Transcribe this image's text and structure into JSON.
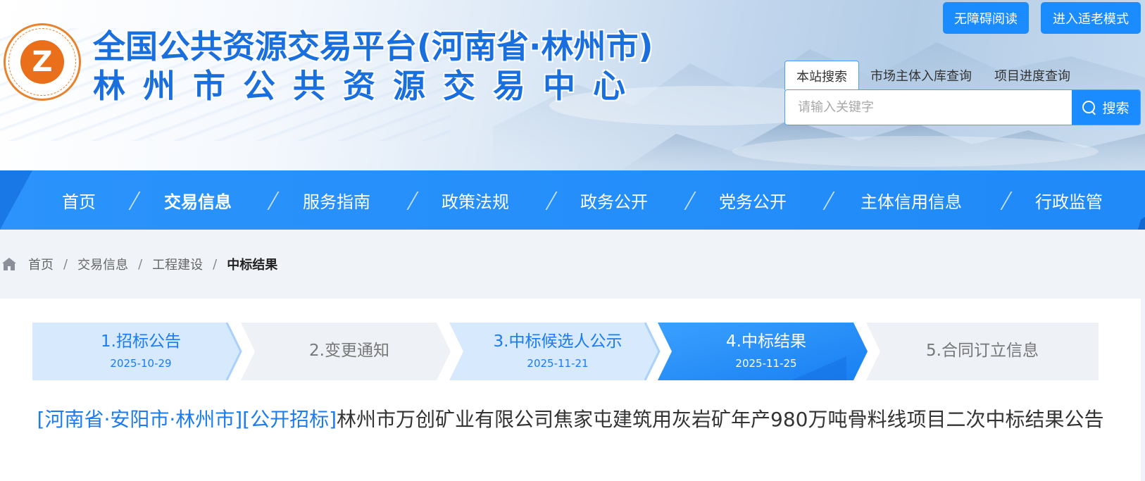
{
  "header": {
    "logo_name": "zhongyuan-logo",
    "title_line1": "全国公共资源交易平台(河南省·林州市)",
    "title_line2": "林州市公共资源交易中心",
    "accessibility_button": "无障碍阅读",
    "elder_mode_button": "进入适老模式",
    "search_tabs": [
      "本站搜索",
      "市场主体入库查询",
      "项目进度查询"
    ],
    "search_placeholder": "请输入关键字",
    "search_button": "搜索"
  },
  "nav": {
    "items": [
      "首页",
      "交易信息",
      "服务指南",
      "政策法规",
      "政务公开",
      "党务公开",
      "主体信用信息",
      "行政监管"
    ],
    "active_index": 1
  },
  "breadcrumb": {
    "items": [
      "首页",
      "交易信息",
      "工程建设",
      "中标结果"
    ],
    "separator": "/"
  },
  "steps": [
    {
      "label": "1.招标公告",
      "date": "2025-10-29",
      "state": "done"
    },
    {
      "label": "2.变更通知",
      "date": "",
      "state": "todo"
    },
    {
      "label": "3.中标候选人公示",
      "date": "2025-11-21",
      "state": "done"
    },
    {
      "label": "4.中标结果",
      "date": "2025-11-25",
      "state": "current"
    },
    {
      "label": "5.合同订立信息",
      "date": "",
      "state": "todo"
    }
  ],
  "article": {
    "region_tag": "[河南省·安阳市·林州市]",
    "method_tag": "[公开招标]",
    "title": "林州市万创矿业有限公司焦家屯建筑用灰岩矿年产980万吨骨料线项目二次中标结果公告"
  },
  "colors": {
    "primary": "#1a8cff",
    "title_blue": "#1a6fde",
    "link_blue": "#1a7cf0",
    "step_done_bg": "#d6e9fd",
    "step_todo_bg": "#eef2f7",
    "logo_orange": "#ea6f1a"
  }
}
